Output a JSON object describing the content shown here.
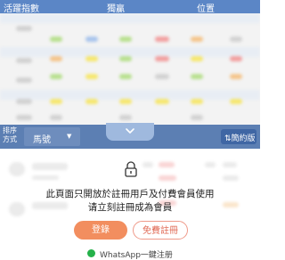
{
  "header": {
    "col1": "活躍指數",
    "col2": "獨贏",
    "col3": "位置"
  },
  "sort": {
    "label": "排序方式",
    "selected": "馬號"
  },
  "simplified_label": "⇅簡約版",
  "lock": {
    "line1": "此頁面只開放於註冊用戶及付費會員使用",
    "line2": "请立刻註冊成為會員"
  },
  "buttons": {
    "login": "登錄",
    "register": "免費註冊"
  },
  "whatsapp": {
    "label": "WhatsApp一鍵注册"
  },
  "colors": {
    "header": "#5b86c6",
    "sortbar": "#5c7fb3",
    "login": "#f28e5f",
    "register_border": "#ef9a8a",
    "whatsapp": "#25b14a"
  }
}
